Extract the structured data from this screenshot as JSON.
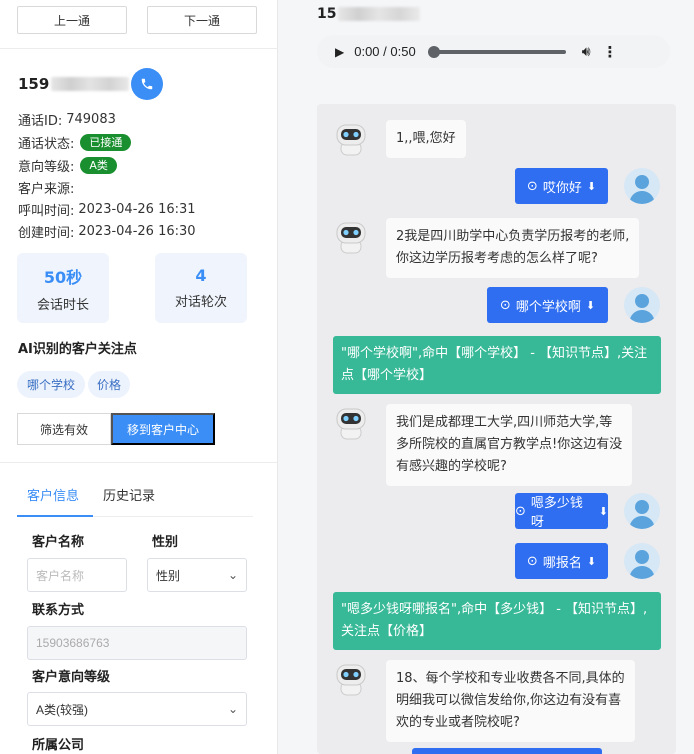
{
  "nav": {
    "prev_label": "上一通",
    "next_label": "下一通"
  },
  "call": {
    "phone_prefix": "159",
    "call_id_label": "通话ID:",
    "call_id": "749083",
    "status_label": "通话状态:",
    "status_value": "已接通",
    "intent_label": "意向等级:",
    "intent_value": "A类",
    "source_label": "客户来源:",
    "call_time_label": "呼叫时间:",
    "call_time": "2023-04-26 16:31",
    "created_label": "创建时间:",
    "created_time": "2023-04-26 16:30"
  },
  "stats": [
    {
      "value": "50秒",
      "label": "会话时长"
    },
    {
      "value": "4",
      "label": "对话轮次"
    }
  ],
  "ai_focus": {
    "title": "AI识别的客户关注点",
    "tags": [
      "哪个学校",
      "价格"
    ]
  },
  "actions": {
    "filter_label": "筛选有效",
    "move_label": "移到客户中心"
  },
  "tabs": [
    "客户信息",
    "历史记录"
  ],
  "form": {
    "name_label": "客户名称",
    "name_placeholder": "客户名称",
    "gender_label": "性别",
    "gender_value": "性别",
    "contact_label": "联系方式",
    "contact_value": "15903686763",
    "intent_label": "客户意向等级",
    "intent_value": "A类(较强)",
    "company_label": "所属公司"
  },
  "player": {
    "phone_prefix": "15",
    "time": "0:00 / 0:50"
  },
  "chat": {
    "bot_1": "1,,喂,您好",
    "user_1": "哎你好",
    "bot_2": "2我是四川助学中心负责学历报考的老师,\n你这边学历报考考虑的怎么样了呢?",
    "user_2": "哪个学校啊",
    "hit_1": "\"哪个学校啊\",命中【哪个学校】 - 【知识节点】,关注点【哪个学校】",
    "bot_3": "我们是成都理工大学,四川师范大学,等\n多所院校的直属官方教学点!你这边有没\n有感兴趣的学校呢?",
    "user_3": "嗯多少钱呀",
    "user_4": "哪报名",
    "hit_2": "\"嗯多少钱呀哪报名\",命中【多少钱】 - 【知识节点】,关注点【价格】",
    "bot_4": "18、每个学校和专业收费各不同,具体的\n明细我可以微信发给你,你这边有没有喜\n欢的专业或者院校呢?"
  },
  "colors": {
    "primary": "#3a8ef6",
    "success": "#1a8f2f",
    "hit": "#37b997",
    "user_bubble": "#2f6ef0"
  }
}
